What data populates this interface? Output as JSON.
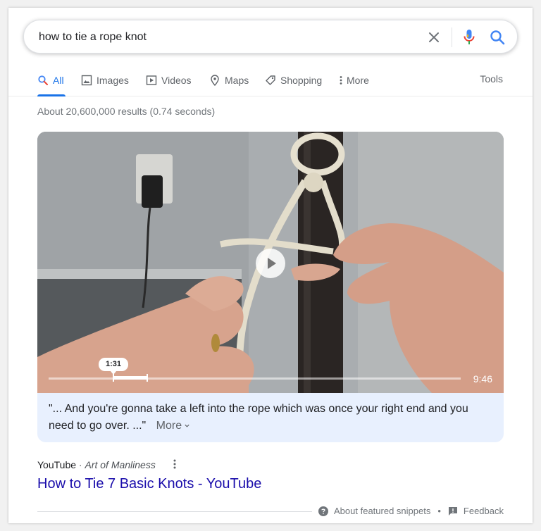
{
  "search": {
    "query": "how to tie a rope knot"
  },
  "tabs": [
    {
      "label": "All",
      "icon": "search-icon",
      "active": true
    },
    {
      "label": "Images",
      "icon": "image-icon"
    },
    {
      "label": "Videos",
      "icon": "video-icon"
    },
    {
      "label": "Maps",
      "icon": "map-pin-icon"
    },
    {
      "label": "Shopping",
      "icon": "tag-icon"
    },
    {
      "label": "More",
      "icon": "more-vertical-icon"
    }
  ],
  "tools_label": "Tools",
  "stats": "About 20,600,000 results (0.74 seconds)",
  "video": {
    "current_time": "1:31",
    "duration": "9:46",
    "progress_fraction": 0.155
  },
  "snippet": {
    "text": "\"... And you're gonna take a left into the rope which was once your right end and you need to go over. ...\"",
    "more_label": "More"
  },
  "result": {
    "source": "YouTube",
    "separator": "·",
    "channel": "Art of Manliness",
    "title": "How to Tie 7 Basic Knots - YouTube"
  },
  "footer": {
    "about_label": "About featured snippets",
    "separator": "•",
    "feedback_label": "Feedback"
  },
  "colors": {
    "link": "#1a0dab",
    "accent": "#1a73e8",
    "snippet_bg": "#e8f0fe"
  }
}
